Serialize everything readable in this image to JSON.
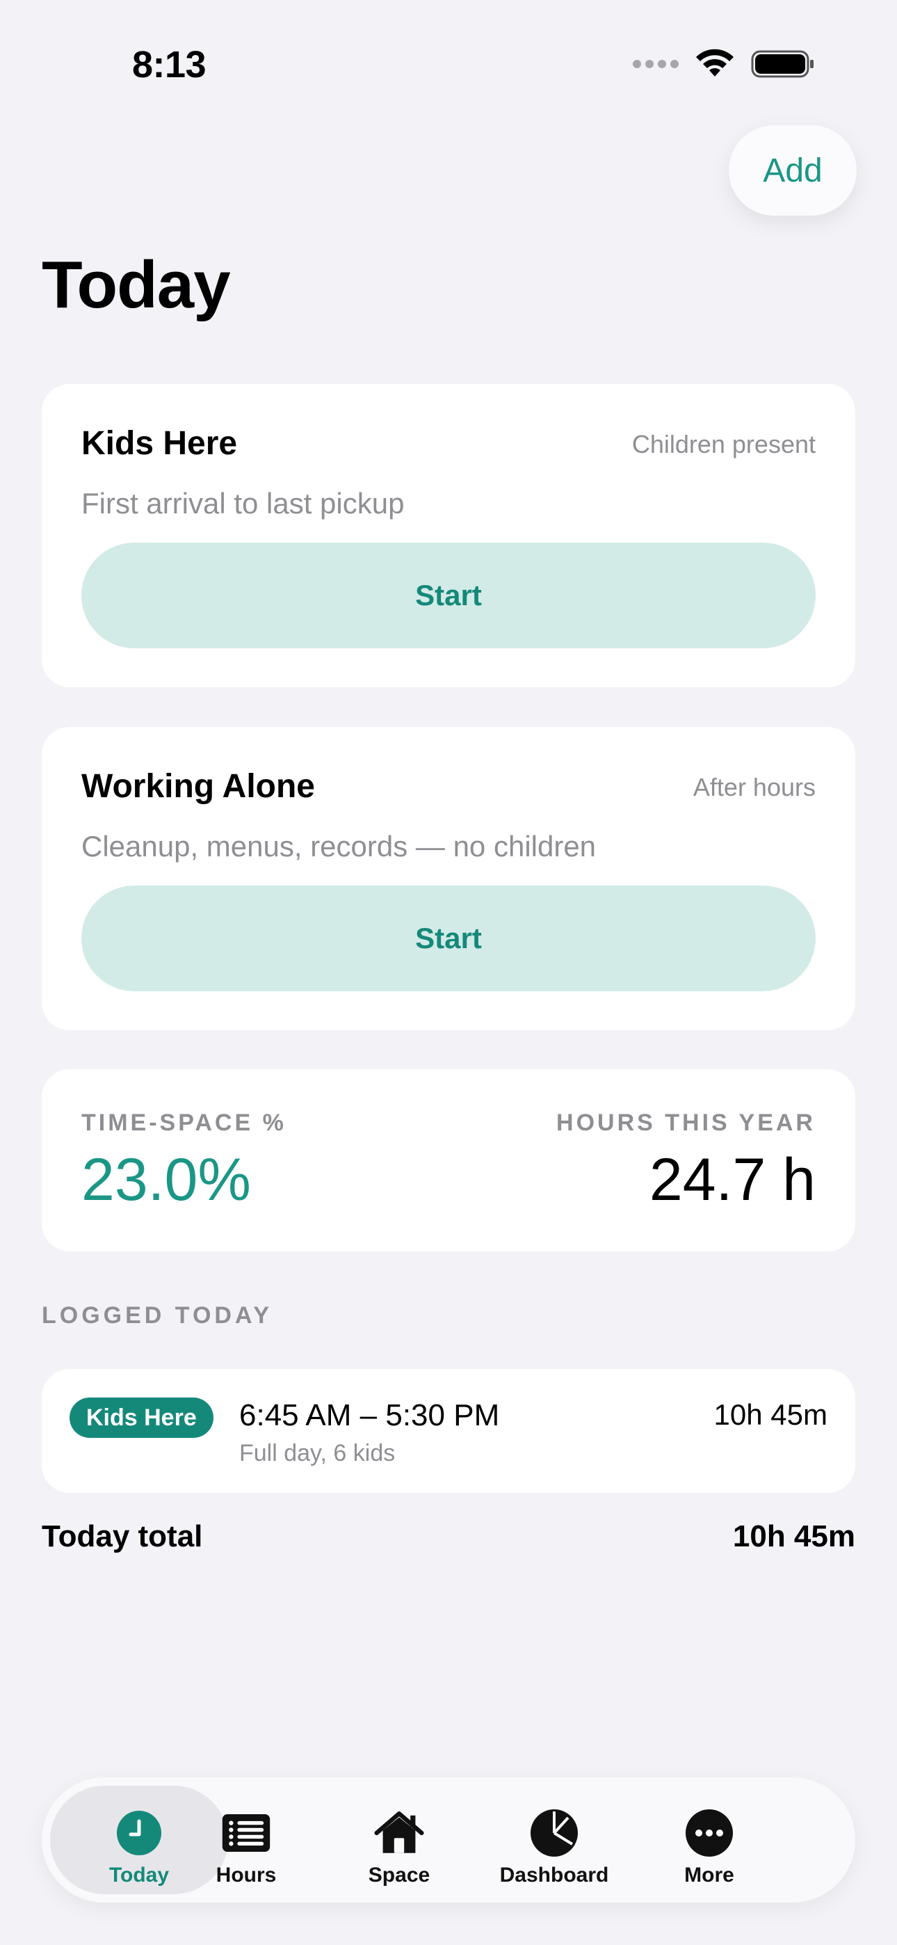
{
  "status_bar": {
    "time": "8:13"
  },
  "header": {
    "add_label": "Add",
    "title": "Today"
  },
  "cards": [
    {
      "title": "Kids Here",
      "tag": "Children present",
      "subtitle": "First arrival to last pickup",
      "button": "Start"
    },
    {
      "title": "Working Alone",
      "tag": "After hours",
      "subtitle": "Cleanup, menus, records — no children",
      "button": "Start"
    }
  ],
  "stats": {
    "time_space_label": "TIME-SPACE %",
    "time_space_value": "23.0%",
    "hours_label": "HOURS THIS YEAR",
    "hours_value": "24.7 h"
  },
  "logged": {
    "section_label": "LOGGED TODAY",
    "entries": [
      {
        "tag": "Kids Here",
        "time": "6:45 AM – 5:30 PM",
        "note": "Full day, 6 kids",
        "duration": "10h 45m"
      }
    ],
    "total_label": "Today total",
    "total_value": "10h 45m"
  },
  "tabs": [
    {
      "label": "Today",
      "icon": "clock-icon",
      "active": true
    },
    {
      "label": "Hours",
      "icon": "list-icon"
    },
    {
      "label": "Space",
      "icon": "house-icon"
    },
    {
      "label": "Dashboard",
      "icon": "pie-chart-icon"
    },
    {
      "label": "More",
      "icon": "ellipsis-icon"
    }
  ],
  "colors": {
    "accent": "#14897a",
    "accent_light": "#d3ebe7",
    "background": "#f2f2f7"
  }
}
